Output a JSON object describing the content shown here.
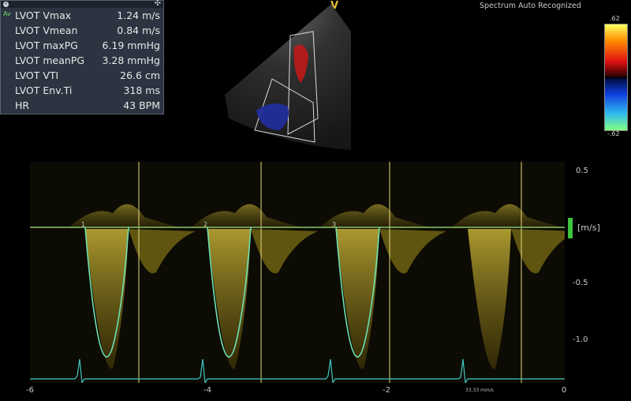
{
  "header": {
    "status": "Spectrum Auto Recognized",
    "probe_marker": "V"
  },
  "measurements": {
    "tag": "Av",
    "rows": [
      {
        "label": "LVOT Vmax",
        "value": "1.24 m/s"
      },
      {
        "label": "LVOT Vmean",
        "value": "0.84 m/s"
      },
      {
        "label": "LVOT maxPG",
        "value": "6.19 mmHg"
      },
      {
        "label": "LVOT meanPG",
        "value": "3.28 mmHg"
      },
      {
        "label": "LVOT VTI",
        "value": "26.6 cm"
      },
      {
        "label": "LVOT Env.Ti",
        "value": "318 ms"
      },
      {
        "label": "HR",
        "value": "43 BPM"
      }
    ]
  },
  "color_bar": {
    "top": ".62",
    "bottom": "-.62"
  },
  "doppler": {
    "unit": "[m/s]",
    "y_ticks": [
      "0.5",
      "-0.5",
      "-1.0"
    ],
    "x_ticks": [
      "-6",
      "-4",
      "-2",
      "0"
    ],
    "sweep_speed": "33.33 mm/s",
    "cycle_markers": [
      "1",
      "2",
      "3"
    ]
  },
  "colors": {
    "trace": "#6ee0b0",
    "spectrum": "#d8c020",
    "ecg": "#40c8c0"
  }
}
